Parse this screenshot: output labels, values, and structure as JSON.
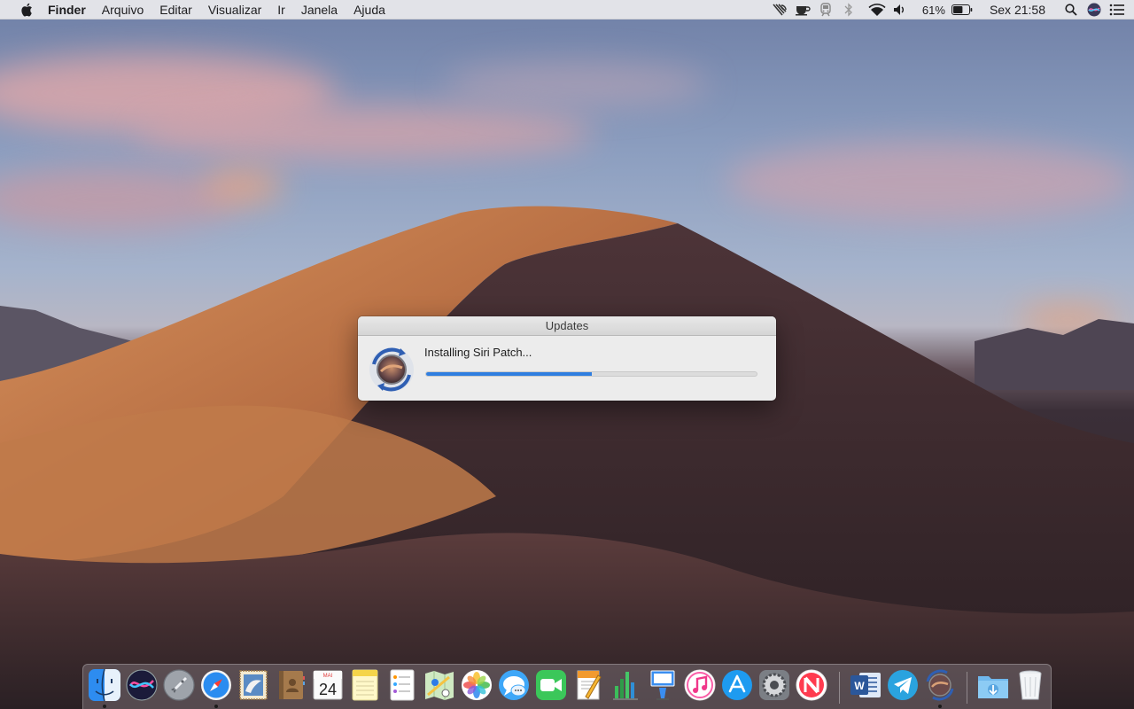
{
  "menubar": {
    "apple_icon": "apple-logo-icon",
    "app_name": "Finder",
    "menus": [
      "Arquivo",
      "Editar",
      "Visualizar",
      "Ir",
      "Janela",
      "Ajuda"
    ],
    "status": {
      "airplay_icon": "airplay-icon",
      "coffee_icon": "caffeine-cup-icon",
      "train_icon": "train-icon",
      "bluetooth_icon": "bluetooth-icon",
      "wifi_icon": "wifi-icon",
      "volume_icon": "volume-icon",
      "battery_percent": "61%",
      "battery_level": 0.61,
      "clock": "Sex 21:58",
      "spotlight_icon": "search-icon",
      "siri_icon": "siri-icon",
      "notification_icon": "notification-center-icon"
    }
  },
  "dialog": {
    "title": "Updates",
    "message": "Installing Siri Patch...",
    "progress": 0.5,
    "accent": "#2f7ee0"
  },
  "dock": {
    "calendar": {
      "month": "MAI",
      "day": "24"
    },
    "items": [
      "finder",
      "siri",
      "launchpad",
      "safari",
      "mail",
      "contacts",
      "calendar",
      "notes",
      "reminders",
      "maps",
      "photos",
      "messages",
      "facetime",
      "pages",
      "numbers",
      "keynote",
      "itunes",
      "app-store",
      "system-preferences",
      "news",
      "word",
      "telegram",
      "updates",
      "downloads",
      "trash"
    ]
  }
}
